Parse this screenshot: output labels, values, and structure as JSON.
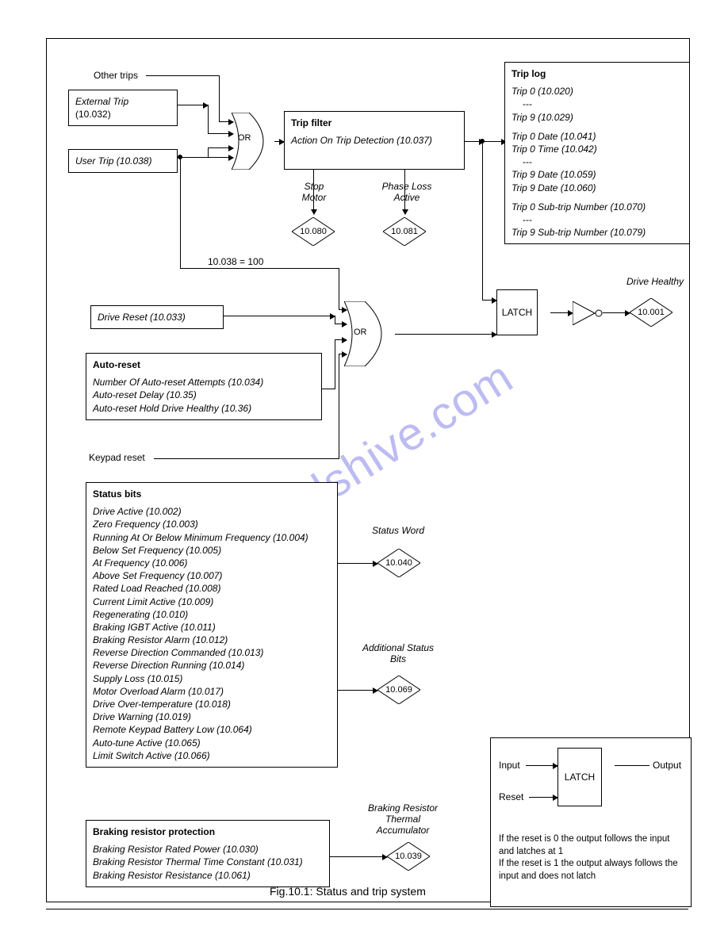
{
  "labels": {
    "other_trips": "Other trips",
    "drive_reset": "Drive Reset (10.033)",
    "keypad_reset": "Keypad reset",
    "cond": "10.038 = 100",
    "stop_motor": "Stop\nMotor",
    "phase_loss": "Phase Loss\nActive",
    "status_word": "Status Word",
    "add_status": "Additional Status\nBits",
    "brk_therm": "Braking Resistor\nThermal\nAccumulator",
    "drive_healthy": "Drive Healthy",
    "latch_input": "Input",
    "latch_output": "Output",
    "latch_reset": "Reset",
    "latch_name": "LATCH",
    "or": "OR"
  },
  "ext_trip": {
    "l1": "External Trip",
    "l2": "(10.032)"
  },
  "user_trip": "User Trip (10.038)",
  "trip_filter": {
    "title": "Trip filter",
    "sub": "Action On Trip Detection (10.037)"
  },
  "autoreset": {
    "title": "Auto-reset",
    "l1": "Number Of Auto-reset Attempts (10.034)",
    "l2": "Auto-reset Delay (10.35)",
    "l3": "Auto-reset Hold Drive Healthy (10.36)"
  },
  "status": {
    "title": "Status bits",
    "items": [
      "Drive Active (10.002)",
      "Zero Frequency (10.003)",
      "Running At Or Below Minimum Frequency (10.004)",
      "Below Set Frequency (10.005)",
      "At Frequency (10.006)",
      "Above Set Frequency (10.007)",
      "Rated Load Reached (10.008)",
      "Current Limit Active (10.009)",
      "Regenerating (10.010)",
      "Braking IGBT Active (10.011)",
      "Braking Resistor Alarm (10.012)",
      "Reverse Direction Commanded (10.013)",
      "Reverse Direction Running (10.014)",
      "Supply Loss (10.015)",
      "Motor Overload Alarm (10.017)",
      "Drive Over-temperature (10.018)",
      "Drive Warning (10.019)",
      "Remote Keypad Battery Low (10.064)",
      "Auto-tune Active (10.065)",
      "Limit Switch Active (10.066)"
    ]
  },
  "brk_prot": {
    "title": "Braking resistor protection",
    "l1": "Braking Resistor Rated Power (10.030)",
    "l2": "Braking Resistor Thermal Time Constant (10.031)",
    "l3": "Braking Resistor Resistance (10.061)"
  },
  "triplog": {
    "title": "Trip log",
    "items": [
      {
        "t": "Trip 0 (10.020)",
        "i": true
      },
      {
        "t": "---",
        "i": false
      },
      {
        "t": "Trip 9 (10.029)",
        "i": true
      },
      {
        "t": "",
        "i": false
      },
      {
        "t": "Trip 0 Date (10.041)",
        "i": true
      },
      {
        "t": "Trip 0 Time (10.042)",
        "i": true
      },
      {
        "t": "---",
        "i": false
      },
      {
        "t": "Trip 9 Date (10.059)",
        "i": true
      },
      {
        "t": "Trip 9 Date (10.060)",
        "i": true
      },
      {
        "t": "",
        "i": false
      },
      {
        "t": "Trip 0 Sub-trip Number (10.070)",
        "i": true
      },
      {
        "t": "---",
        "i": false
      },
      {
        "t": "Trip 9 Sub-trip Number (10.079)",
        "i": true
      }
    ]
  },
  "diamonds": {
    "d1": "10.080",
    "d2": "10.081",
    "d3": "10.001",
    "d4": "10.040",
    "d5": "10.069",
    "d6": "10.039"
  },
  "latch_note": {
    "l1": "If the reset is 0 the output follows the input and latches at 1",
    "l2": "If the reset is 1 the output always follows the input and does not latch"
  },
  "caption": "Fig.10.1: Status and trip system",
  "watermark": "manualshive.com"
}
